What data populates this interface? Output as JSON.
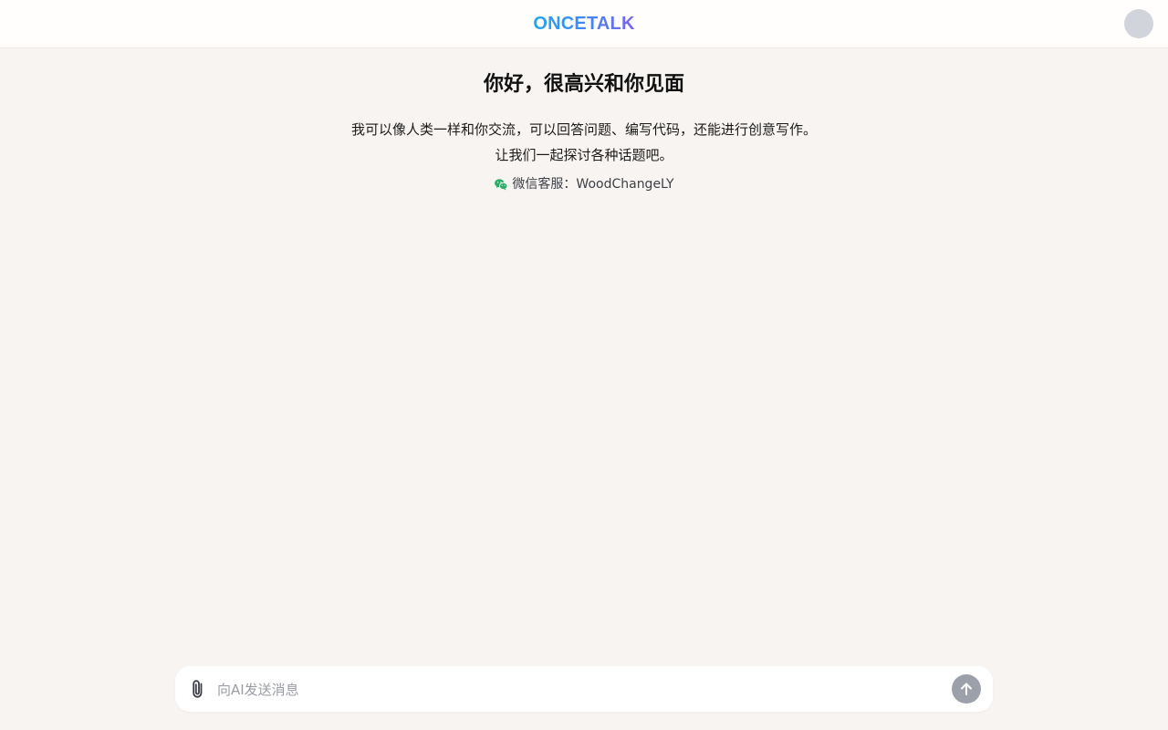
{
  "header": {
    "brand": "ONCETALK"
  },
  "welcome": {
    "title": "你好，很高兴和你见面",
    "desc_line1": "我可以像人类一样和你交流，可以回答问题、编写代码，还能进行创意写作。",
    "desc_line2": "让我们一起探讨各种话题吧。",
    "wechat_label": "微信客服：WoodChangeLY"
  },
  "composer": {
    "placeholder": "向AI发送消息",
    "value": ""
  },
  "icons": {
    "wechat": "wechat-icon",
    "attach": "paperclip-icon",
    "send": "arrow-up-icon"
  },
  "colors": {
    "background": "#f7f4f1",
    "brand_start": "#22a6ef",
    "brand_end": "#7a63ee",
    "wechat_green": "#2aae67",
    "send_button": "#9ca0aa"
  }
}
